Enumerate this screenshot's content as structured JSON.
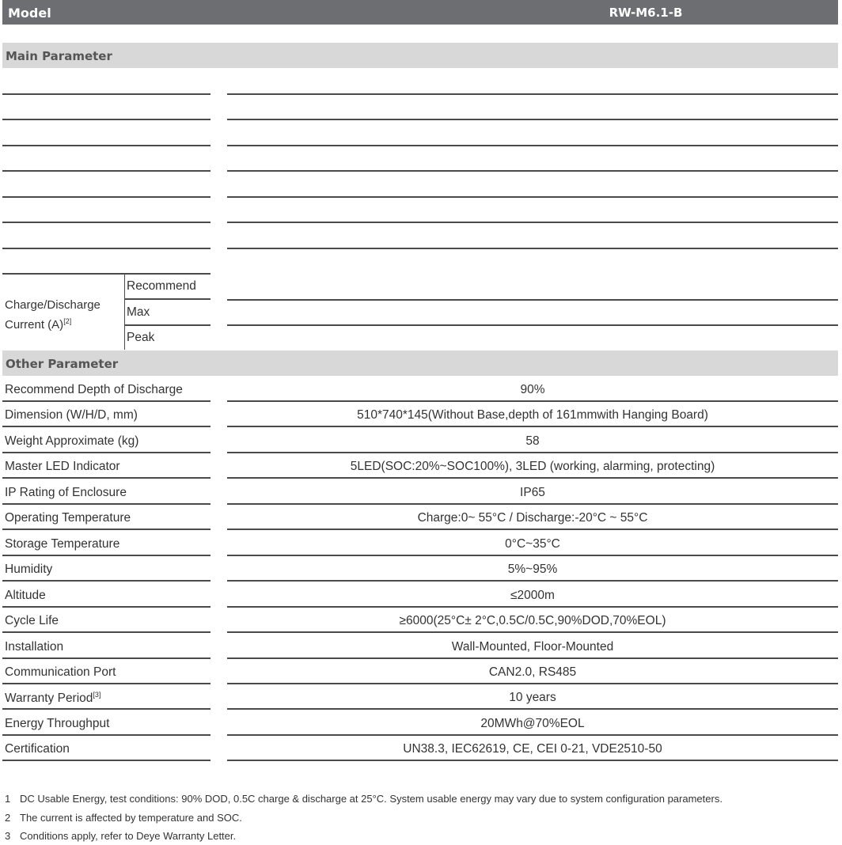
{
  "header": {
    "label": "Model",
    "model": "RW-M6.1-B"
  },
  "sections": {
    "main": "Main Parameter",
    "other": "Other Parameter"
  },
  "charge_discharge": {
    "label_line1": "Charge/Discharge",
    "label_line2": "Current  (A)",
    "label_sup": "[2]",
    "sub_rows": [
      "Recommend",
      "Max",
      "Peak"
    ]
  },
  "other_rows": [
    {
      "key": "Recommend  Depth  of  Discharge",
      "value": "90%"
    },
    {
      "key": "Dimension  (W/H/D,  mm)",
      "value": "510*740*145(Without  Base,depth  of  161mmwith  Hanging  Board)"
    },
    {
      "key": "Weight  Approximate  (kg)",
      "value": "58"
    },
    {
      "key": "Master  LED  Indicator",
      "value": "5LED(SOC:20%~SOC100%), 3LED  (working,  alarming,  protecting)"
    },
    {
      "key": "IP  Rating  of  Enclosure",
      "value": "IP65"
    },
    {
      "key": "Operating  Temperature",
      "value": "Charge:0~ 55°C  /  Discharge:-20°C  ~  55°C"
    },
    {
      "key": "Storage  Temperature",
      "value": "0°C~35°C"
    },
    {
      "key": "Humidity",
      "value": "5%~95%"
    },
    {
      "key": "Altitude",
      "value": "≤2000m"
    },
    {
      "key": "Cycle  Life",
      "value": "≥6000(25°C± 2°C,0.5C/0.5C,90%DOD,70%EOL)"
    },
    {
      "key": "Installation",
      "value": "Wall-Mounted,   Floor-Mounted"
    },
    {
      "key": "Communication  Port",
      "value": "CAN2.0,  RS485"
    },
    {
      "key": "Warranty  Period",
      "value": "10  years",
      "sup": "[3]"
    },
    {
      "key": "Energy  Throughput",
      "value": "20MWh@70%EOL"
    },
    {
      "key": "Certification",
      "value": "UN38.3,  IEC62619,  CE,  CEI  0-21,  VDE2510-50"
    }
  ],
  "footnotes": [
    {
      "num": "1",
      "text": "DC  Usable  Energy,  test  conditions:  90%  DOD,  0.5C  charge  &  discharge  at  25°C.  System  usable  energy  may  vary  due  to  system  configuration  parameters."
    },
    {
      "num": "2",
      "text": "The  current  is  affected  by  temperature  and  SOC."
    },
    {
      "num": "3",
      "text": "Conditions  apply,  refer  to  Deye  Warranty  Letter."
    }
  ]
}
